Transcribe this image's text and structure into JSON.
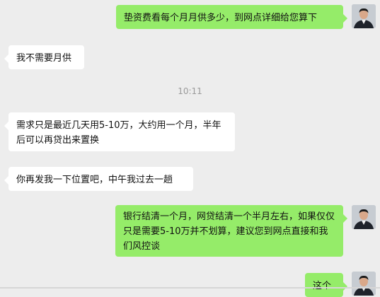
{
  "chat": {
    "messages": [
      {
        "side": "out",
        "text": "垫资费看每个月月供多少，到网点详细给您算下"
      },
      {
        "side": "in",
        "text": "我不需要月供"
      },
      {
        "side": "in",
        "text": "需求只是最近几天用5-10万，大约用一个月，半年后可以再贷出来置换"
      },
      {
        "side": "in",
        "text": "你再发我一下位置吧，中午我过去一趟"
      },
      {
        "side": "out",
        "text": "银行结清一个月，网贷结清一个半月左右，如果仅仅只是需要5-10万并不划算，建议您到网点直接和我们风控谈"
      },
      {
        "side": "out",
        "text": "这个"
      }
    ],
    "timestamp": "10:11"
  },
  "colors": {
    "background": "#ededed",
    "outgoing_bubble": "#95ec69",
    "incoming_bubble": "#ffffff"
  }
}
